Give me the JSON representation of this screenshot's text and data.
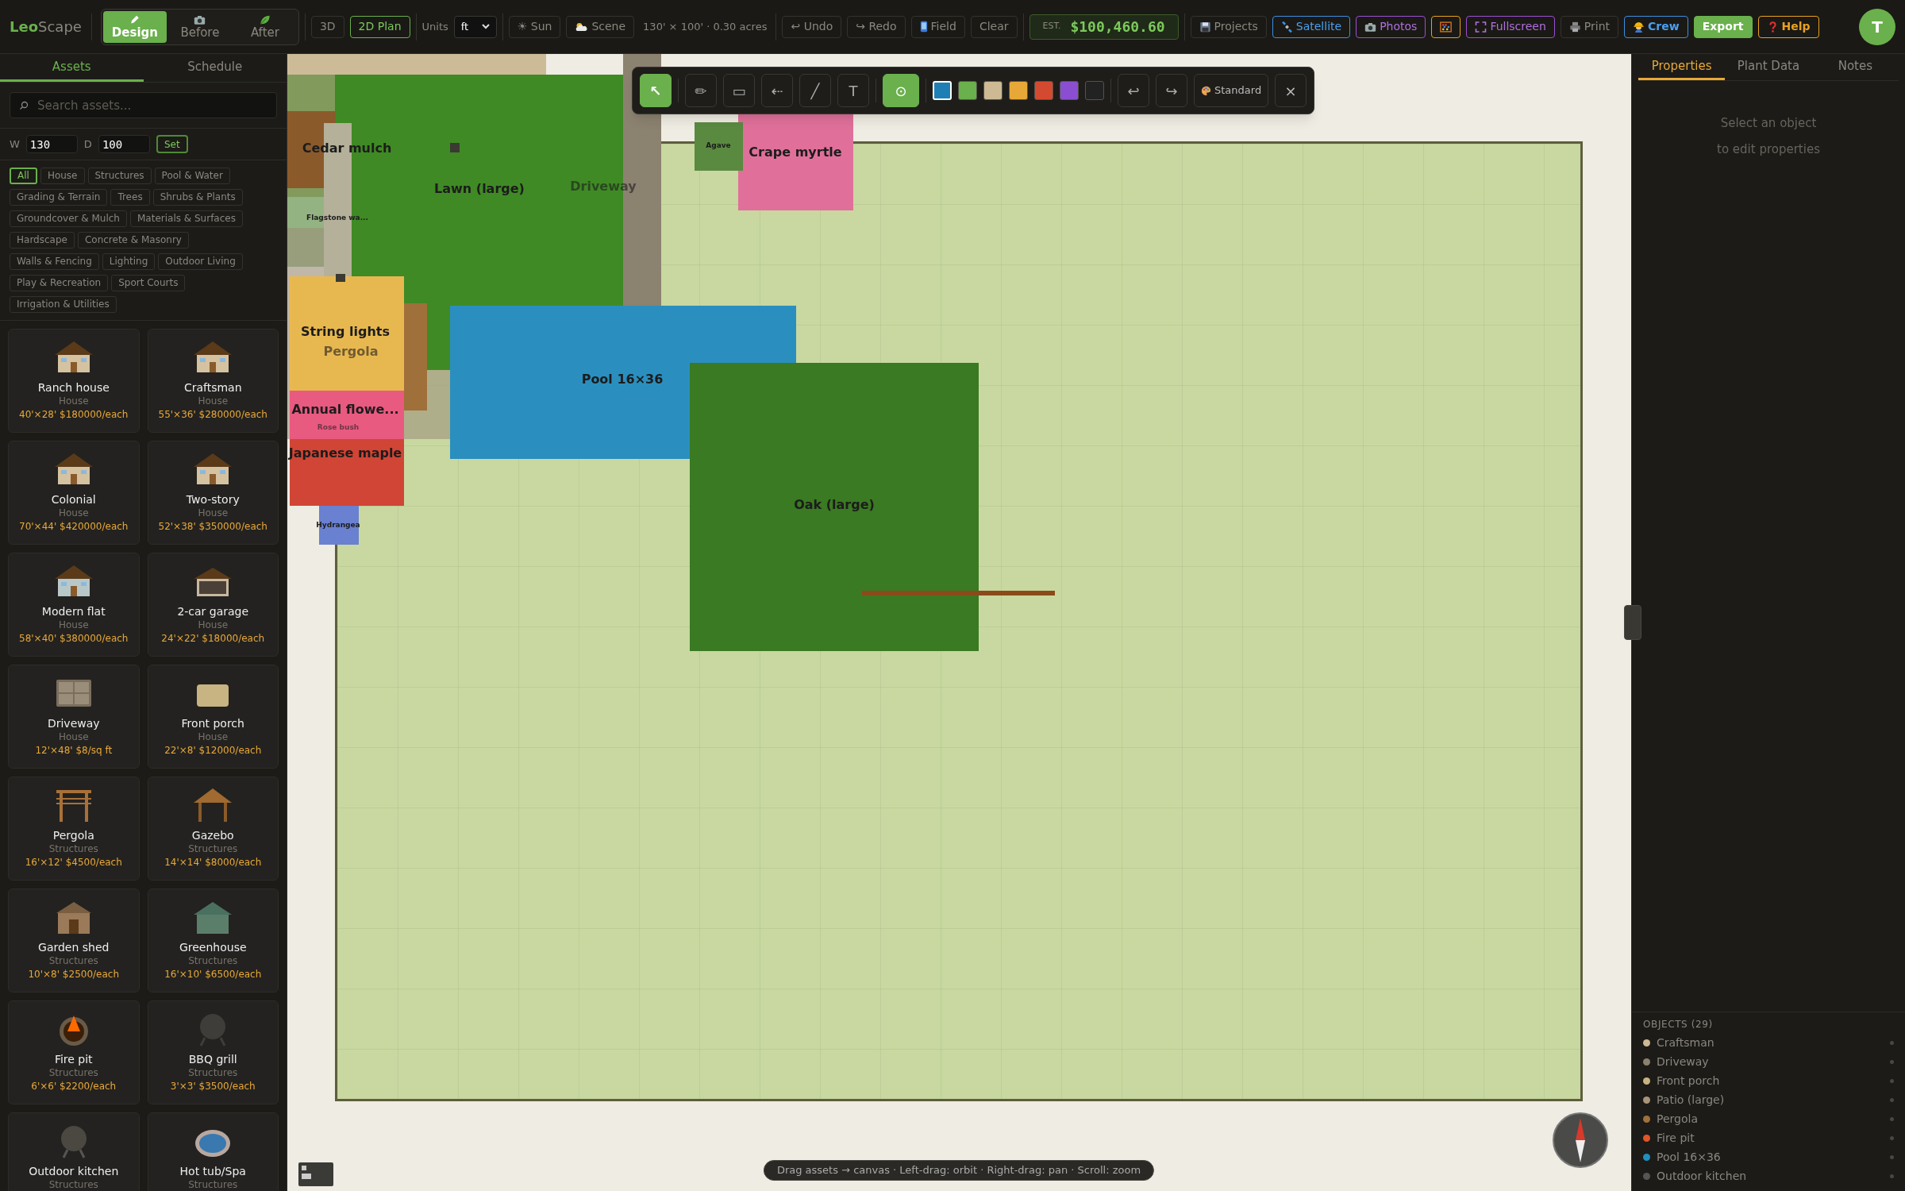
{
  "app": {
    "logo_main": "Leo",
    "logo_rest": "Scape"
  },
  "modes": [
    {
      "label": "Design",
      "selected": true
    },
    {
      "label": "Before",
      "selected": false
    },
    {
      "label": "After",
      "selected": false
    }
  ],
  "views": [
    {
      "label": "3D",
      "selected": false
    },
    {
      "label": "2D Plan",
      "selected": true
    }
  ],
  "units": {
    "label": "Units",
    "value": "ft"
  },
  "scene_buttons": [
    "☀ Sun",
    "Scene"
  ],
  "lot_size": "130' × 100' · 0.30 acres",
  "edit_buttons": [
    "↩ Undo",
    "↪ Redo",
    "Field",
    "Clear"
  ],
  "estimate": {
    "label": "EST.",
    "value": "$100,460.60"
  },
  "right_buttons": [
    {
      "label": "Projects",
      "kind": "plain"
    },
    {
      "label": "Satellite",
      "kind": "blue"
    },
    {
      "label": "Photos",
      "kind": "purple"
    },
    {
      "kind": "orange"
    },
    {
      "label": "Fullscreen",
      "kind": "purple"
    },
    {
      "label": "Print",
      "kind": "plain"
    },
    {
      "label": "Crew",
      "kind": "crew"
    },
    {
      "label": "Export",
      "kind": "green"
    },
    {
      "label": "Help",
      "kind": "help"
    }
  ],
  "avatar": "T",
  "left_tabs": [
    {
      "label": "Assets",
      "selected": true
    },
    {
      "label": "Schedule",
      "selected": false
    }
  ],
  "search": {
    "placeholder": "Search assets..."
  },
  "lot_fields": {
    "w_label": "W",
    "w_value": "130",
    "d_label": "D",
    "d_value": "100",
    "button": "Set"
  },
  "categories": [
    {
      "label": "All",
      "selected": true
    },
    {
      "label": "House",
      "selected": false
    },
    {
      "label": "Structures",
      "selected": false
    },
    {
      "label": "Pool & Water",
      "selected": false
    },
    {
      "label": "Grading & Terrain",
      "selected": false
    },
    {
      "label": "Trees",
      "selected": false
    },
    {
      "label": "Shrubs & Plants",
      "selected": false
    },
    {
      "label": "Groundcover & Mulch",
      "selected": false
    },
    {
      "label": "Materials & Surfaces",
      "selected": false
    },
    {
      "label": "Hardscape",
      "selected": false
    },
    {
      "label": "Concrete & Masonry",
      "selected": false
    },
    {
      "label": "Walls & Fencing",
      "selected": false
    },
    {
      "label": "Lighting",
      "selected": false
    },
    {
      "label": "Outdoor Living",
      "selected": false
    },
    {
      "label": "Play & Recreation",
      "selected": false
    },
    {
      "label": "Sport Courts",
      "selected": false
    },
    {
      "label": "Irrigation & Utilities",
      "selected": false
    }
  ],
  "assets": [
    {
      "name": "Ranch house",
      "category": "House",
      "price": "40'×28' $180000/each",
      "kind": "house"
    },
    {
      "name": "Craftsman",
      "category": "House",
      "price": "55'×36' $280000/each",
      "kind": "house"
    },
    {
      "name": "Colonial",
      "category": "House",
      "price": "70'×44' $420000/each",
      "kind": "house"
    },
    {
      "name": "Two-story",
      "category": "House",
      "price": "52'×38' $350000/each",
      "kind": "house"
    },
    {
      "name": "Modern flat",
      "category": "House",
      "price": "58'×40' $380000/each",
      "kind": "modern"
    },
    {
      "name": "2-car garage",
      "category": "House",
      "price": "24'×22' $18000/each",
      "kind": "garage"
    },
    {
      "name": "Driveway",
      "category": "House",
      "price": "12'×48' $8/sq ft",
      "kind": "driveway"
    },
    {
      "name": "Front porch",
      "category": "House",
      "price": "22'×8' $12000/each",
      "kind": "porch"
    },
    {
      "name": "Pergola",
      "category": "Structures",
      "price": "16'×12' $4500/each",
      "kind": "pergola"
    },
    {
      "name": "Gazebo",
      "category": "Structures",
      "price": "14'×14' $8000/each",
      "kind": "gazebo"
    },
    {
      "name": "Garden shed",
      "category": "Structures",
      "price": "10'×8' $2500/each",
      "kind": "shed"
    },
    {
      "name": "Greenhouse",
      "category": "Structures",
      "price": "16'×10' $6500/each",
      "kind": "greenhouse"
    },
    {
      "name": "Fire pit",
      "category": "Structures",
      "price": "6'×6' $2200/each",
      "kind": "firepit"
    },
    {
      "name": "BBQ grill",
      "category": "Structures",
      "price": "3'×3' $3500/each",
      "kind": "grill"
    },
    {
      "name": "Outdoor kitchen",
      "category": "Structures",
      "kind": "kitchen"
    },
    {
      "name": "Hot tub/Spa",
      "category": "Structures",
      "kind": "spa"
    }
  ],
  "plan_items": [
    {
      "label": "Driveway",
      "color": "#8c8270",
      "dimmed": true
    },
    {
      "label": "Lawn (large)",
      "color": "#3f8a25",
      "dimmed": false
    },
    {
      "label": "Cedar mulch",
      "color": "#8b5a2b",
      "dimmed": false
    },
    {
      "label": "Flagstone wa...",
      "color": "#b5b09a",
      "dimmed": false
    },
    {
      "label": "Pergola",
      "color": "#a0703a",
      "dimmed": true
    },
    {
      "label": "Pool 16×36",
      "color": "#2a8fbf",
      "dimmed": false
    },
    {
      "label": "Oak (large)",
      "color": "#3a7a22",
      "dimmed": false
    },
    {
      "label": "Crape myrtle",
      "color": "#e0709a",
      "dimmed": false
    },
    {
      "label": "Agave",
      "color": "#5a8a40",
      "dimmed": false
    },
    {
      "label": "String lights",
      "color": "#e8b850",
      "dimmed": false
    },
    {
      "label": "Annual flowe...",
      "color": "#e85a80",
      "dimmed": false
    },
    {
      "label": "Rose bush",
      "dimmed": true
    },
    {
      "label": "Japanese maple",
      "color": "#d04535",
      "dimmed": false
    },
    {
      "label": "Hydrangea",
      "color": "#6a80d0",
      "dimmed": false
    }
  ],
  "draw_tools": [
    {
      "label": "↖",
      "selected": true
    },
    {
      "label": "✏",
      "selected": false
    },
    {
      "label": "▭",
      "selected": false
    },
    {
      "label": "⇠",
      "selected": false
    },
    {
      "label": "╱",
      "selected": false
    },
    {
      "label": "T",
      "selected": false
    }
  ],
  "snap": {
    "label": "⊙",
    "on": true
  },
  "swatches": [
    {
      "color": "#1f7fb5",
      "selected": true
    },
    {
      "color": "#6ab04c",
      "selected": false
    },
    {
      "color": "#cdb994",
      "selected": false
    },
    {
      "color": "#e8a838",
      "selected": false
    },
    {
      "color": "#d44a30",
      "selected": false
    },
    {
      "color": "#8a4fd0",
      "selected": false
    },
    {
      "color": "#222222",
      "selected": false
    }
  ],
  "history_buttons": [
    "↩",
    "↪"
  ],
  "style_button": "Standard",
  "close_button": "×",
  "hint": "Drag assets → canvas · Left-drag: orbit · Right-drag: pan · Scroll: zoom",
  "right_tabs": [
    {
      "label": "Properties",
      "selected": true
    },
    {
      "label": "Plant Data",
      "selected": false
    },
    {
      "label": "Notes",
      "selected": false
    }
  ],
  "empty_state": [
    "Select an object",
    "to edit properties"
  ],
  "objects": {
    "title": "OBJECTS (29)",
    "items": [
      {
        "label": "Craftsman",
        "color": "#cdb994"
      },
      {
        "label": "Driveway",
        "color": "#8c8270"
      },
      {
        "label": "Front porch",
        "color": "#c8b480"
      },
      {
        "label": "Patio (large)",
        "color": "#a89478"
      },
      {
        "label": "Pergola",
        "color": "#a0703a"
      },
      {
        "label": "Fire pit",
        "color": "#e0552a"
      },
      {
        "label": "Pool 16×36",
        "color": "#1f8fc0"
      },
      {
        "label": "Outdoor kitchen",
        "color": "#555555"
      }
    ]
  }
}
